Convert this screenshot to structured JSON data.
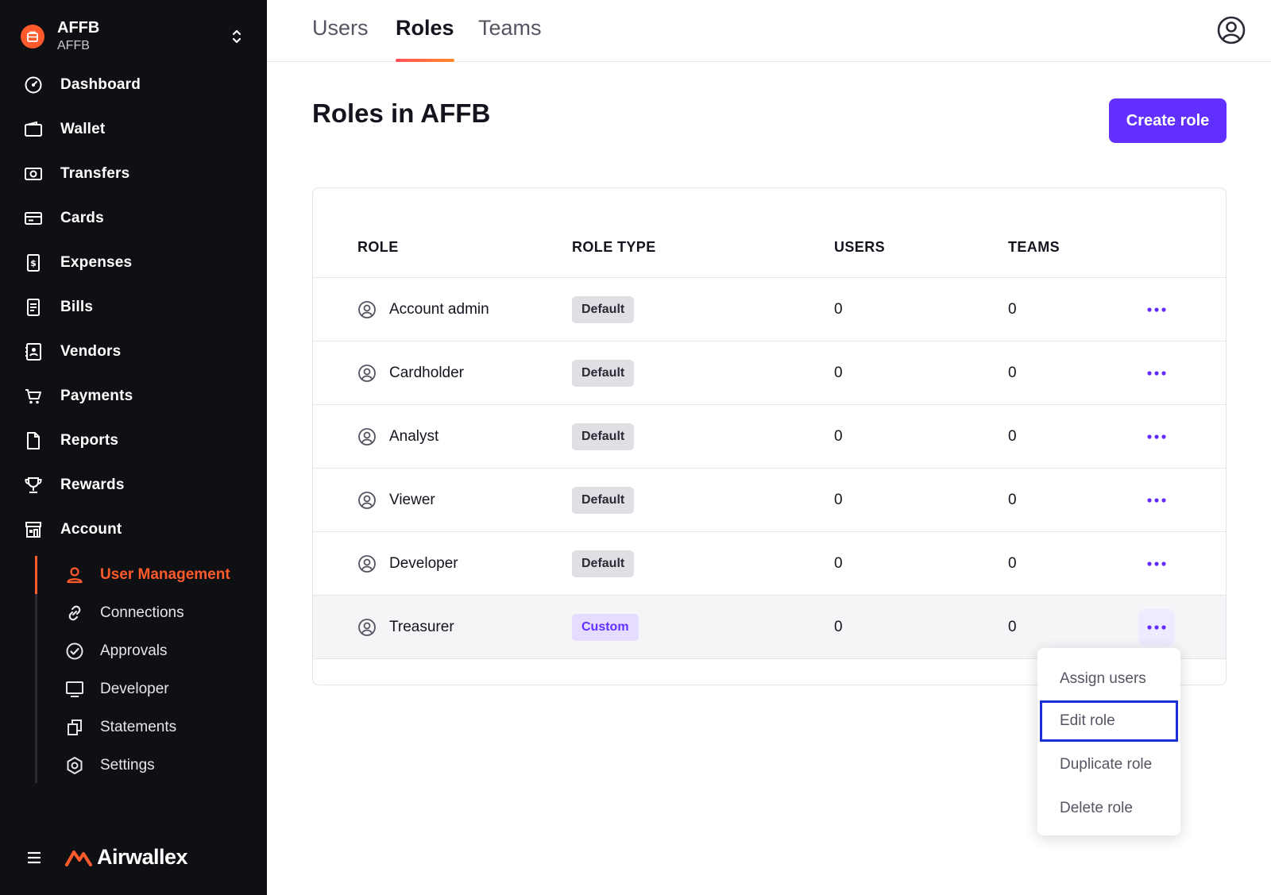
{
  "org": {
    "name": "AFFB",
    "subtitle": "AFFB"
  },
  "nav": {
    "items": [
      {
        "label": "Dashboard",
        "icon": "dashboard-icon"
      },
      {
        "label": "Wallet",
        "icon": "wallet-icon"
      },
      {
        "label": "Transfers",
        "icon": "transfers-icon"
      },
      {
        "label": "Cards",
        "icon": "card-icon"
      },
      {
        "label": "Expenses",
        "icon": "expenses-icon"
      },
      {
        "label": "Bills",
        "icon": "bills-icon"
      },
      {
        "label": "Vendors",
        "icon": "vendors-icon"
      },
      {
        "label": "Payments",
        "icon": "cart-icon"
      },
      {
        "label": "Reports",
        "icon": "reports-icon"
      },
      {
        "label": "Rewards",
        "icon": "trophy-icon"
      },
      {
        "label": "Account",
        "icon": "store-icon"
      }
    ],
    "sub_items": [
      {
        "label": "User Management",
        "icon": "user-icon",
        "active": true
      },
      {
        "label": "Connections",
        "icon": "link-icon"
      },
      {
        "label": "Approvals",
        "icon": "check-circle-icon"
      },
      {
        "label": "Developer",
        "icon": "monitor-icon"
      },
      {
        "label": "Statements",
        "icon": "copy-icon"
      },
      {
        "label": "Settings",
        "icon": "gear-icon"
      }
    ]
  },
  "brand": {
    "name": "Airwallex"
  },
  "tabs": [
    {
      "label": "Users",
      "active": false
    },
    {
      "label": "Roles",
      "active": true
    },
    {
      "label": "Teams",
      "active": false
    }
  ],
  "page": {
    "title": "Roles in AFFB",
    "create_label": "Create role"
  },
  "table": {
    "headers": {
      "role": "ROLE",
      "role_type": "ROLE TYPE",
      "users": "USERS",
      "teams": "TEAMS"
    },
    "rows": [
      {
        "role": "Account admin",
        "type": "Default",
        "users": "0",
        "teams": "0"
      },
      {
        "role": "Cardholder",
        "type": "Default",
        "users": "0",
        "teams": "0"
      },
      {
        "role": "Analyst",
        "type": "Default",
        "users": "0",
        "teams": "0"
      },
      {
        "role": "Viewer",
        "type": "Default",
        "users": "0",
        "teams": "0"
      },
      {
        "role": "Developer",
        "type": "Default",
        "users": "0",
        "teams": "0"
      },
      {
        "role": "Treasurer",
        "type": "Custom",
        "users": "0",
        "teams": "0"
      }
    ]
  },
  "menu": {
    "items": [
      {
        "label": "Assign users"
      },
      {
        "label": "Edit role",
        "focused": true
      },
      {
        "label": "Duplicate role"
      },
      {
        "label": "Delete role"
      }
    ]
  },
  "colors": {
    "accent": "#612fff",
    "brand": "#ff5a2b",
    "sidebar_bg": "#0f1014",
    "focus_ring": "#1a2fd6"
  }
}
